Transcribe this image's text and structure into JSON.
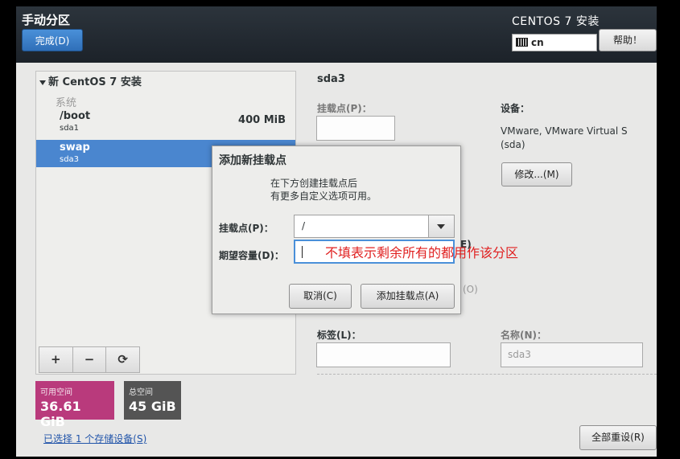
{
  "header": {
    "title": "手动分区",
    "done_label": "完成(D)",
    "product": "CENTOS 7 安装",
    "keyboard_layout": "cn",
    "help_label": "帮助！"
  },
  "left_pane": {
    "root_label": "新 CentOS 7 安装",
    "section_label": "系统",
    "partitions": [
      {
        "mount": "/boot",
        "device": "sda1",
        "size": "400 MiB"
      },
      {
        "mount": "swap",
        "device": "sda3",
        "size": ""
      }
    ],
    "toolbar": {
      "add": "+",
      "remove": "−",
      "refresh": "⟳"
    },
    "available_label": "可用空间",
    "available_value": "36.61 GiB",
    "total_label": "总空间",
    "total_value": "45 GiB",
    "selected_devices_link": "已选择 1 个存储设备(S)"
  },
  "right_pane": {
    "title": "sda3",
    "mount_point_label": "挂载点(P)：",
    "device_label": "设备：",
    "device_value_line1": "VMware, VMware Virtual S",
    "device_value_line2": "(sda)",
    "modify_label": "修改...(M)",
    "partial_e": "E)",
    "partial_o": "(O)",
    "tag_label": "标签(L)：",
    "name_label": "名称(N)：",
    "name_value": "sda3",
    "reset_all_label": "全部重设(R)"
  },
  "dialog": {
    "title": "添加新挂载点",
    "desc_line1": "在下方创建挂载点后",
    "desc_line2": "有更多自定义选项可用。",
    "mount_label": "挂载点(P)：",
    "mount_value": "/",
    "capacity_label": "期望容量(D)：",
    "capacity_value": "",
    "cancel_label": "取消(C)",
    "add_label": "添加挂载点(A)"
  },
  "annotation": "不填表示剩余所有的都用作该分区",
  "colors": {
    "accent": "#4a86cf",
    "available_space": "#b93a7c",
    "total_space": "#545454",
    "annotation": "#e02020"
  }
}
